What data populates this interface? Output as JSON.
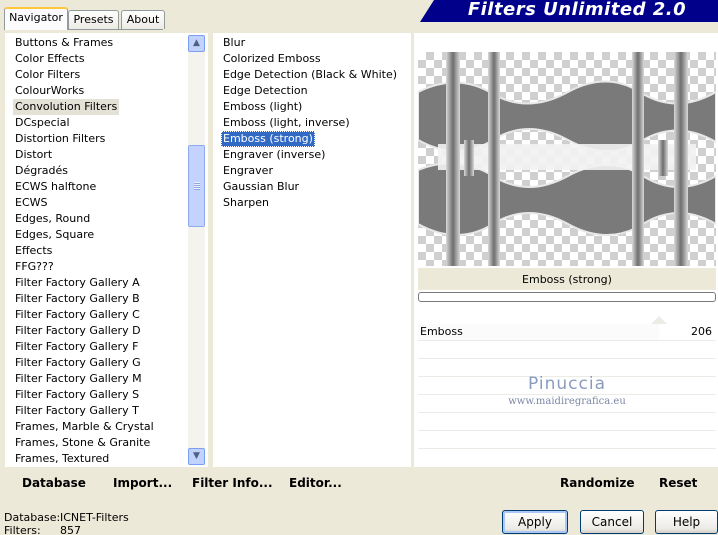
{
  "tabs": [
    {
      "label": "Navigator",
      "active": true
    },
    {
      "label": "Presets",
      "active": false
    },
    {
      "label": "About",
      "active": false
    }
  ],
  "banner_title": "Filters Unlimited 2.0",
  "categories": [
    "Buttons & Frames",
    "Color Effects",
    "Color Filters",
    "ColourWorks",
    "Convolution Filters",
    "DCspecial",
    "Distortion Filters",
    "Distort",
    "Dégradés",
    "ECWS halftone",
    "ECWS",
    "Edges, Round",
    "Edges, Square",
    "Effects",
    "FFG???",
    "Filter Factory Gallery A",
    "Filter Factory Gallery B",
    "Filter Factory Gallery C",
    "Filter Factory Gallery D",
    "Filter Factory Gallery F",
    "Filter Factory Gallery G",
    "Filter Factory Gallery M",
    "Filter Factory Gallery S",
    "Filter Factory Gallery T",
    "Frames, Marble & Crystal",
    "Frames, Stone & Granite",
    "Frames, Textured"
  ],
  "selected_category": "Convolution Filters",
  "filters": [
    "Blur",
    "Colorized Emboss",
    "Edge Detection (Black & White)",
    "Edge Detection",
    "Emboss (light)",
    "Emboss (light, inverse)",
    "Emboss (strong)",
    "Engraver (inverse)",
    "Engraver",
    "Gaussian Blur",
    "Sharpen"
  ],
  "selected_filter": "Emboss (strong)",
  "preview_caption": "Emboss (strong)",
  "slider": {
    "label": "Emboss",
    "value": "206",
    "fraction": 0.81
  },
  "watermark": {
    "name": "Pinuccia",
    "url": "www.maidiregrafica.eu"
  },
  "toolbar": {
    "database": "Database",
    "import": "Import...",
    "filter_info": "Filter Info...",
    "editor": "Editor...",
    "randomize": "Randomize",
    "reset": "Reset"
  },
  "status": {
    "database_label": "Database:",
    "database_value": "ICNET-Filters",
    "filters_label": "Filters:",
    "filters_value": "857"
  },
  "buttons": {
    "apply": "Apply",
    "cancel": "Cancel",
    "help": "Help"
  },
  "colors": {
    "banner": "#00008b",
    "selection": "#316ac5",
    "background": "#ece9d8"
  }
}
